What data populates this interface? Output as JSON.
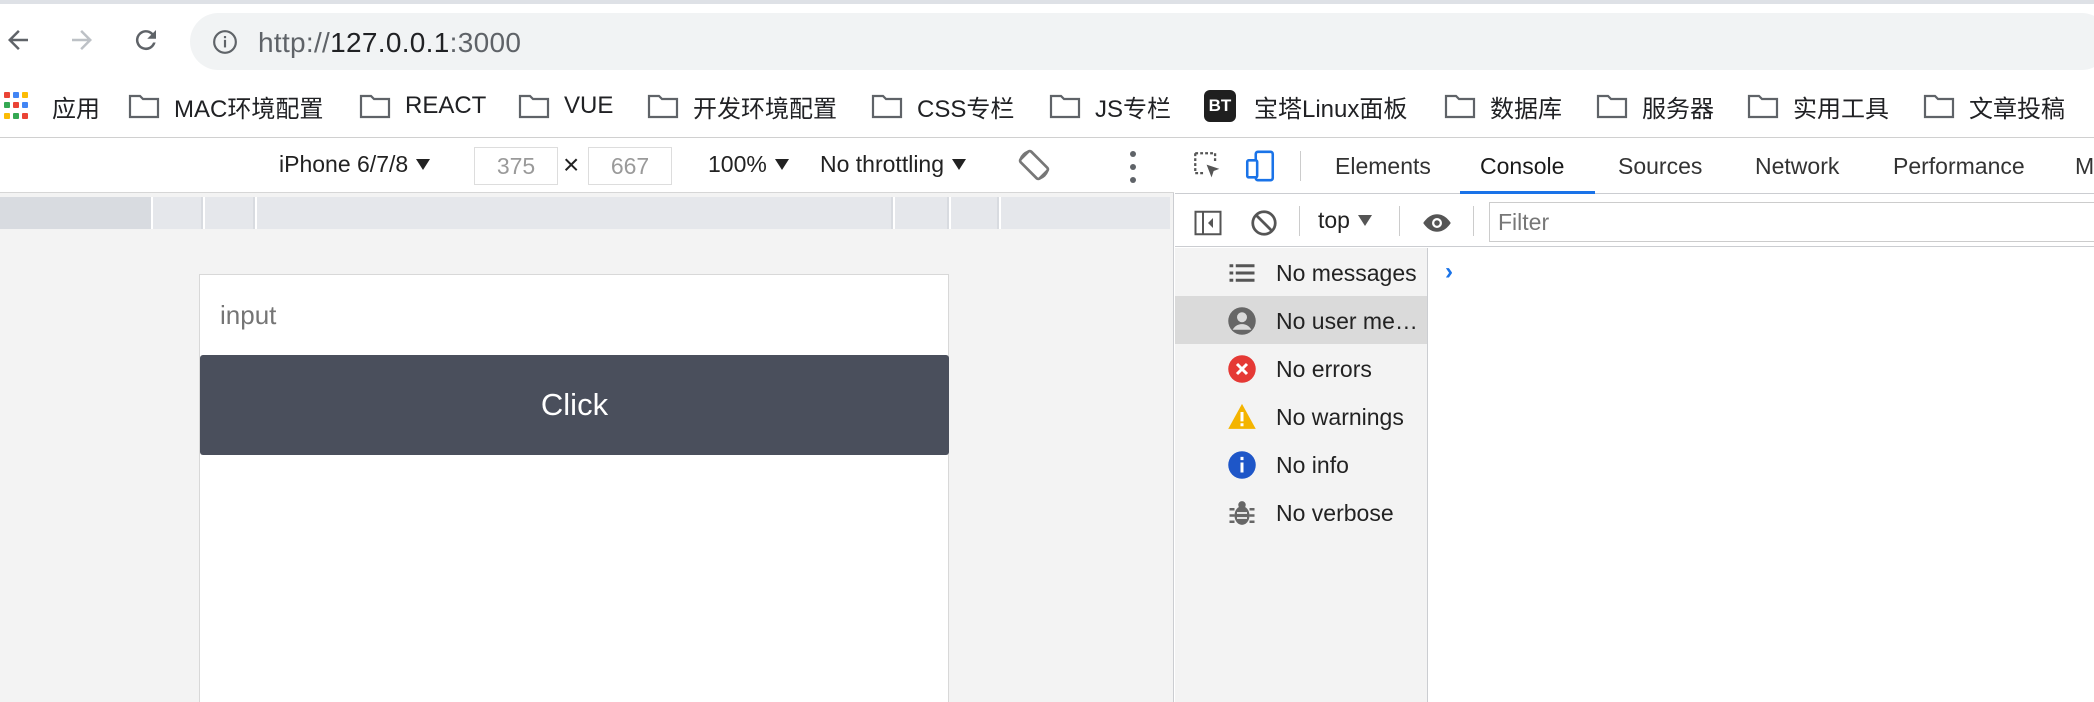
{
  "browser": {
    "url_scheme": "http://",
    "url_host": "127.0.0.1",
    "url_port": ":3000",
    "nav_icons": [
      "back-arrow-icon",
      "forward-arrow-icon",
      "reload-icon",
      "info-icon"
    ]
  },
  "bookmarks": {
    "apps_label": "应用",
    "items": [
      {
        "label": "MAC环境配置",
        "icon": "folder-icon"
      },
      {
        "label": "REACT",
        "icon": "folder-icon"
      },
      {
        "label": "VUE",
        "icon": "folder-icon"
      },
      {
        "label": "开发环境配置",
        "icon": "folder-icon"
      },
      {
        "label": "CSS专栏",
        "icon": "folder-icon"
      },
      {
        "label": "JS专栏",
        "icon": "folder-icon"
      },
      {
        "label": "宝塔Linux面板",
        "icon": "bt-logo",
        "logo_text": "BT"
      },
      {
        "label": "数据库",
        "icon": "folder-icon"
      },
      {
        "label": "服务器",
        "icon": "folder-icon"
      },
      {
        "label": "实用工具",
        "icon": "folder-icon"
      },
      {
        "label": "文章投稿",
        "icon": "folder-icon"
      }
    ]
  },
  "device_toolbar": {
    "device": "iPhone 6/7/8",
    "width": "375",
    "height": "667",
    "times": "×",
    "zoom": "100%",
    "throttling": "No throttling"
  },
  "page": {
    "input_placeholder": "input",
    "button_label": "Click",
    "button_color": "#4a4f5c"
  },
  "devtools": {
    "tabs": [
      "Elements",
      "Console",
      "Sources",
      "Network",
      "Performance",
      "M"
    ],
    "active_tab": "Console",
    "context": "top",
    "filter_placeholder": "Filter",
    "sidebar": [
      {
        "label": "No messages",
        "icon": "list-icon"
      },
      {
        "label": "No user me…",
        "icon": "user-icon",
        "selected": true
      },
      {
        "label": "No errors",
        "icon": "error-icon",
        "color": "#e53935"
      },
      {
        "label": "No warnings",
        "icon": "warning-icon",
        "color": "#f4b400"
      },
      {
        "label": "No info",
        "icon": "info-icon",
        "color": "#1e56c8"
      },
      {
        "label": "No verbose",
        "icon": "bug-icon"
      }
    ],
    "prompt_glyph": "›",
    "accent": "#1a73e8"
  }
}
